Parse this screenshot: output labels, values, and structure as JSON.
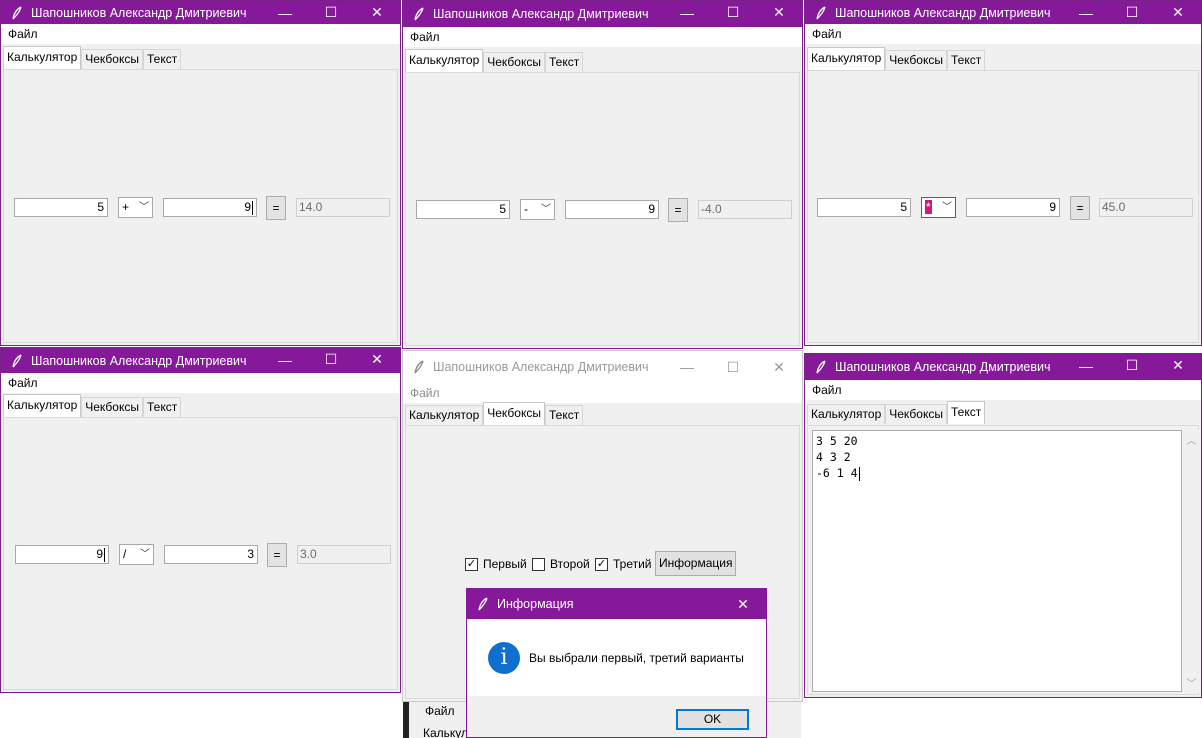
{
  "title": "Шапошников Александр Дмитриевич",
  "menu": "Файл",
  "tabs": {
    "calc": "Калькулятор",
    "checks": "Чекбоксы",
    "text": "Текст"
  },
  "controls": {
    "minimize": "—",
    "maximize": "☐",
    "close": "✕"
  },
  "calc_windows": [
    {
      "a": "5",
      "op": "+",
      "b": "9",
      "result": "14.0"
    },
    {
      "a": "5",
      "op": "-",
      "b": "9",
      "result": "-4.0"
    },
    {
      "a": "5",
      "op": "*",
      "b": "9",
      "result": "45.0"
    },
    {
      "a": "9",
      "op": "/",
      "b": "3",
      "result": "3.0"
    }
  ],
  "equals_label": "=",
  "checkboxes": [
    {
      "label": "Первый",
      "checked": true
    },
    {
      "label": "Второй",
      "checked": false
    },
    {
      "label": "Третий",
      "checked": true
    }
  ],
  "info_button": "Информация",
  "dialog": {
    "title": "Информация",
    "message": "Вы выбрали первый, третий варианты",
    "ok": "OK"
  },
  "text_lines": [
    "3 5 20",
    "4 3 2",
    "-6 1 4"
  ],
  "behind_window": {
    "menu": "Файл",
    "tab": "Калькулятор"
  },
  "colors": {
    "titlebar": "#86199a",
    "info_icon": "#0f6fcf"
  }
}
